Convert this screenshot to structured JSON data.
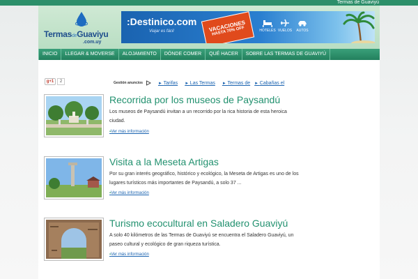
{
  "site_name": "Termas de Guaviyú",
  "logo": {
    "brand": "Termas",
    "de": "de",
    "brand2": "Guaviyu",
    "domain": ".com.uy"
  },
  "banner": {
    "brand": ":Destinico.com",
    "tagline": "Viajar es fácil",
    "promo_line1": "VACACIONES",
    "promo_line2": "HASTA 70% OFF",
    "services": [
      "HOTELES",
      "VUELOS",
      "AUTOS"
    ]
  },
  "nav": [
    "INICIO",
    "LLEGAR & MOVERSE",
    "ALOJAMIENTO",
    "DÓNDE COMER",
    "QUÉ HACER",
    "SOBRE LAS TERMAS DE GUAVIYÚ"
  ],
  "share": {
    "gplus": "g+1",
    "count": "2"
  },
  "ads": {
    "gestion": "Gestión anuncios",
    "links": [
      "Tarifas",
      "Las Termas",
      "Termas de",
      "Cabañas el"
    ]
  },
  "articles": [
    {
      "title": "Recorrida por los museos de Paysandú",
      "excerpt": "Los museos de Paysandú invitan a un recorrido por la rica historia de esta heroica ciudad.",
      "more": "Ver más información"
    },
    {
      "title": "Visita a la Meseta Artigas",
      "excerpt": "Por su gran interés geográfico, histórico y ecológico, la Meseta de Artigas es uno de los lugares turísticos más importantes de Paysandú, a solo 37 ...",
      "more": "Ver más información"
    },
    {
      "title": "Turismo ecocultural en Saladero Guaviyú",
      "excerpt": "A solo 40 kilómetros de las Termas de Guaviyú se encuentra el Saladero Guaviyú, un paseo cultural y ecológico de gran riqueza turística.",
      "more": "Ver más información"
    }
  ],
  "colors": {
    "accent": "#22916f",
    "nav": "#2d8f6a",
    "link": "#1a63b0"
  }
}
